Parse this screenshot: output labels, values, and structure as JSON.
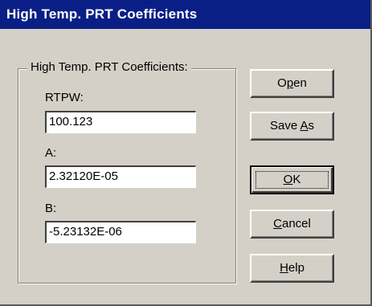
{
  "window": {
    "title": "High Temp. PRT Coefficients"
  },
  "group": {
    "legend": "High Temp. PRT Coefficients:"
  },
  "fields": {
    "rtpw": {
      "label": "RTPW:",
      "value": "100.123"
    },
    "a": {
      "label": "A:",
      "value": "2.32120E-05"
    },
    "b": {
      "label": "B:",
      "value": "-5.23132E-06"
    }
  },
  "buttons": {
    "open": {
      "pre": "O",
      "accel": "p",
      "post": "en"
    },
    "save_as": {
      "pre": "Save ",
      "accel": "A",
      "post": "s"
    },
    "ok": {
      "pre": "",
      "accel": "O",
      "post": "K"
    },
    "cancel": {
      "pre": "",
      "accel": "C",
      "post": "ancel"
    },
    "help": {
      "pre": "",
      "accel": "H",
      "post": "elp"
    }
  },
  "colors": {
    "titlebar": "#0a1f85",
    "dialog_face": "#d4d0c8",
    "input_bg": "#ffffff"
  }
}
